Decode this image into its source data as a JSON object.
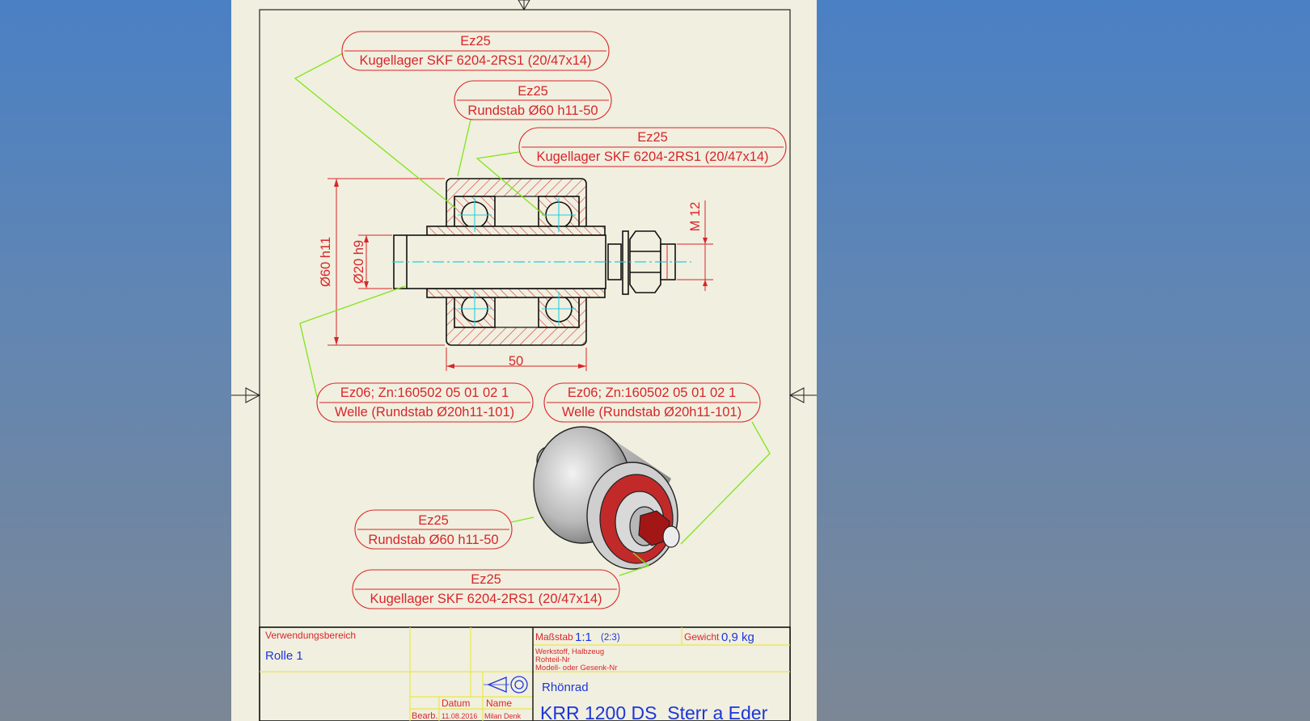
{
  "colors": {
    "background": "#5a84b8",
    "sheet": "#f1efdf",
    "annotation_red": "#d8262a",
    "leader_green": "#7fe51c",
    "centerline_cyan": "#22cfe0",
    "titleblock_yellow": "#e8e84a",
    "value_blue": "#1c36d8"
  },
  "callouts": [
    {
      "line1": "Ez25",
      "line2": "Kugellager SKF 6204-2RS1 (20/47x14)"
    },
    {
      "line1": "Ez25",
      "line2": "Rundstab Ø60 h11-50"
    },
    {
      "line1": "Ez25",
      "line2": "Kugellager SKF 6204-2RS1 (20/47x14)"
    },
    {
      "line1": "Ez06; Zn:160502  05 01 02 1",
      "line2": "Welle (Rundstab Ø20h11-101)"
    },
    {
      "line1": "Ez06; Zn:160502  05 01 02 1",
      "line2": "Welle (Rundstab Ø20h11-101)"
    },
    {
      "line1": "Ez25",
      "line2": "Rundstab Ø60 h11-50"
    },
    {
      "line1": "Ez25",
      "line2": "Kugellager SKF 6204-2RS1 (20/47x14)"
    }
  ],
  "dimensions": {
    "outer_diameter": "Ø60 h11",
    "shaft_diameter": "Ø20 h9",
    "thread": "M 12",
    "length": "50"
  },
  "title_block": {
    "usage_label": "Verwendungsbereich",
    "usage_value": "Rolle 1",
    "scale_label": "Maßstab",
    "scale_value": "1:1",
    "scale_secondary": "(2:3)",
    "weight_label": "Gewicht",
    "weight_value": "0,9 kg",
    "material_label": "Werkstoff, Halbzeug",
    "raw_part_label": "Rohteil-Nr",
    "model_label": "Modell- oder Gesenk-Nr",
    "project": "Rhönrad",
    "date_header": "Datum",
    "name_header": "Name",
    "row_label": "Bearb.",
    "date_value": "11.08.2016",
    "name_value": "Milan Denk",
    "drawing_title": "KRR 1200 DS  Sterr a Eder"
  },
  "icons": [
    "projection-symbol-icon"
  ]
}
